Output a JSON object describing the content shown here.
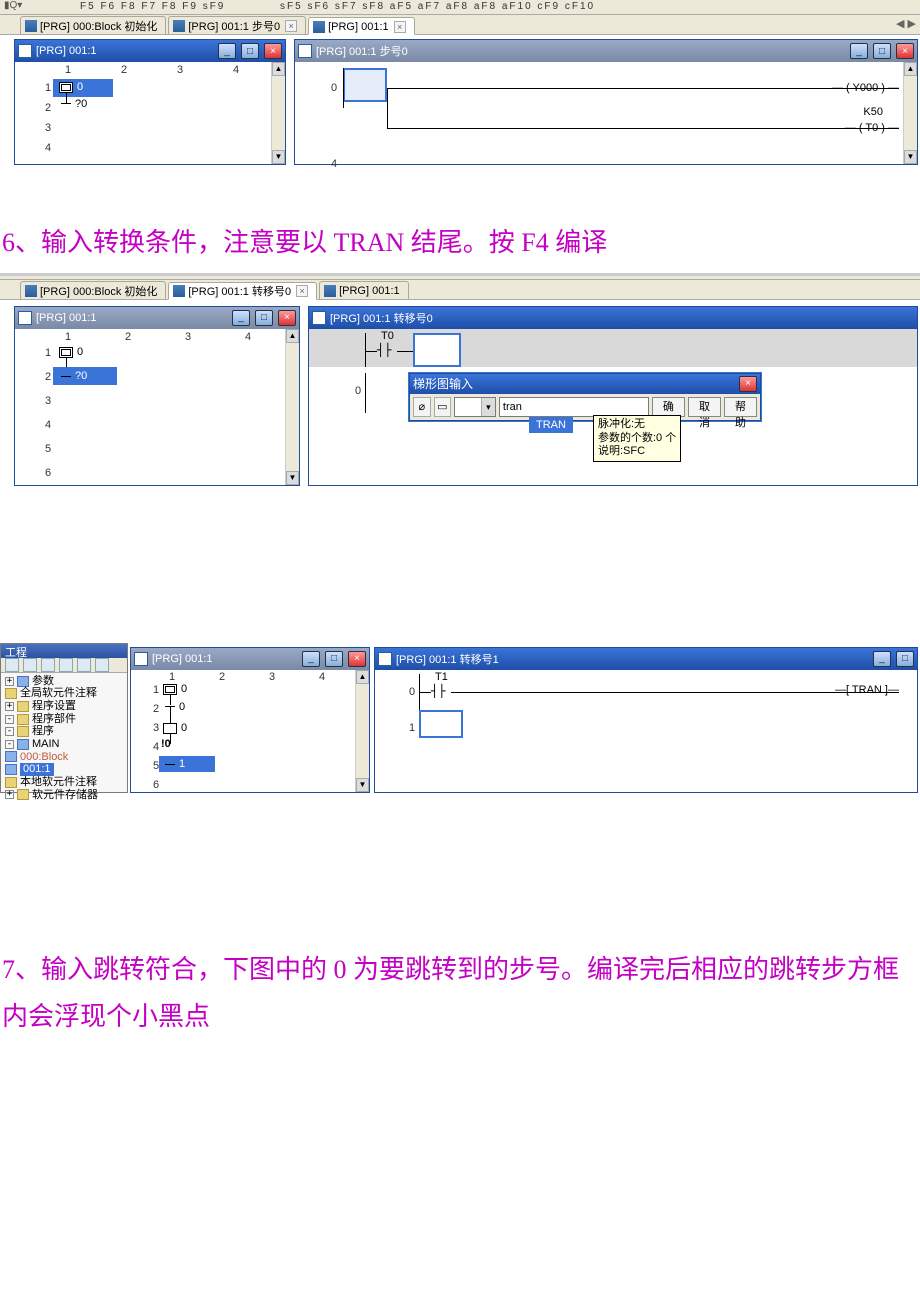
{
  "headings": {
    "h6": "6、输入转换条件，注意要以 TRAN 结尾。按 F4 编译",
    "h7": "7、输入跳转符合，下图中的 0 为要跳转到的步号。编译完后相应的跳转步方框内会浮现个小黑点"
  },
  "toolbar": {
    "f_row": "F5  F6  F8  F7  F8  F9  sF9",
    "sf_row": "sF5  sF6  sF7  sF8  aF5  aF7  aF8  aF8  aF10  cF9  cF10",
    "dots": "··· ··· ···"
  },
  "fig1": {
    "tabs": [
      {
        "label": "[PRG] 000:Block 初始化"
      },
      {
        "label": "[PRG] 001:1 步号0"
      },
      {
        "label": "[PRG] 001:1"
      }
    ],
    "left_title": "[PRG] 001:1",
    "right_title": "[PRG] 001:1 步号0",
    "cols": [
      "1",
      "2",
      "3",
      "4"
    ],
    "rows": [
      "1",
      "2",
      "3",
      "4"
    ],
    "sfc": {
      "step0": "0",
      "trans": "?0"
    },
    "ladder": {
      "row0": "0",
      "row1": "4",
      "coil0": "Y000",
      "k": "K50",
      "coil1": "T0"
    }
  },
  "fig2": {
    "tabs": [
      {
        "label": "[PRG] 000:Block 初始化"
      },
      {
        "label": "[PRG] 001:1 转移号0"
      },
      {
        "label": "[PRG] 001:1"
      }
    ],
    "left_title": "[PRG] 001:1",
    "right_title": "[PRG] 001:1 转移号0",
    "cols": [
      "1",
      "2",
      "3",
      "4"
    ],
    "rows": [
      "1",
      "2",
      "3",
      "4",
      "5",
      "6"
    ],
    "sfc": {
      "step0": "0",
      "trans": "?0"
    },
    "top_label": "T0",
    "row0": "0",
    "dialog": {
      "title": "梯形图输入",
      "value": "tran",
      "ok": "确定",
      "cancel": "取消",
      "help": "帮助",
      "hint_item": "TRAN",
      "tip0": "脉冲化:无",
      "tip1": "参数的个数:0 个",
      "tip2": "说明:SFC"
    }
  },
  "fig3": {
    "proj_title": "工程",
    "tree": {
      "n_params": "参数",
      "n_global": "全局软元件注释",
      "n_progset": "程序设置",
      "n_progpart": "程序部件",
      "n_prog": "程序",
      "n_main": "MAIN",
      "n_blk": "000:Block",
      "n_001": "001:1",
      "n_local": "本地软元件注释",
      "n_devmem": "软元件存储器"
    },
    "left_title": "[PRG] 001:1",
    "right_title": "[PRG] 001:1 转移号1",
    "cols": [
      "1",
      "2",
      "3",
      "4"
    ],
    "rows": [
      "1",
      "2",
      "3",
      "4",
      "5",
      "6"
    ],
    "sfc": {
      "s0": "0",
      "t0": "0",
      "s1": "0",
      "t1": "1"
    },
    "top_label": "T1",
    "row0": "0",
    "row1": "1",
    "coil": "TRAN"
  },
  "winbtn": {
    "min": "_",
    "max": "□",
    "close": "×",
    "dd": "▾",
    "up": "▲",
    "dn": "▼"
  }
}
